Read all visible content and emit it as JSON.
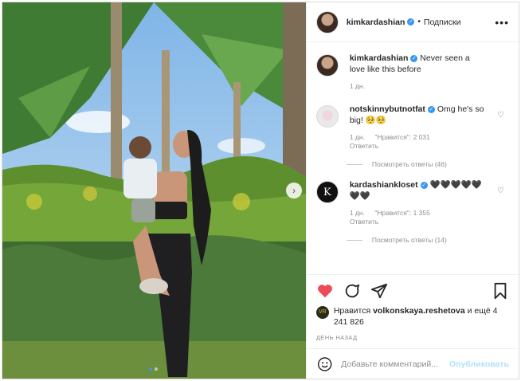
{
  "post": {
    "author": "kimkardashian",
    "separator": "•",
    "follow_label": "Подписки",
    "more_icon": "more-dots-icon"
  },
  "caption": {
    "username": "kimkardashian",
    "text": "Never seen a love like this before",
    "time": "1 дн."
  },
  "comments": [
    {
      "username": "notskinnybutnotfat",
      "text": "Omg he's so big! 🥺🥺",
      "time": "1 дн.",
      "likes": "\"Нравится\": 2 031",
      "reply": "Ответить",
      "replies": "Посмотреть ответы (46)"
    },
    {
      "username": "kardashiankloset",
      "text": "🖤🖤🖤🖤🖤🖤🖤",
      "time": "1 дн.",
      "likes": "\"Нравится\": 1 355",
      "reply": "Ответить",
      "replies": "Посмотреть ответы (14)"
    }
  ],
  "likes": {
    "prefix": "Нравится",
    "user": "volkonskaya.reshetova",
    "suffix": "и ещё 4 241 826"
  },
  "date": "ДЕНЬ НАЗАД",
  "add_comment": {
    "placeholder": "Добавьте комментарий...",
    "publish_label": "Опубликовать"
  },
  "colors": {
    "like_red": "#ed4956",
    "verified_blue": "#3897f0",
    "publish_disabled": "#b2dffc"
  },
  "icons": [
    "heart-filled-icon",
    "comment-icon",
    "share-icon",
    "bookmark-icon",
    "emoji-icon",
    "next-arrow-icon"
  ]
}
